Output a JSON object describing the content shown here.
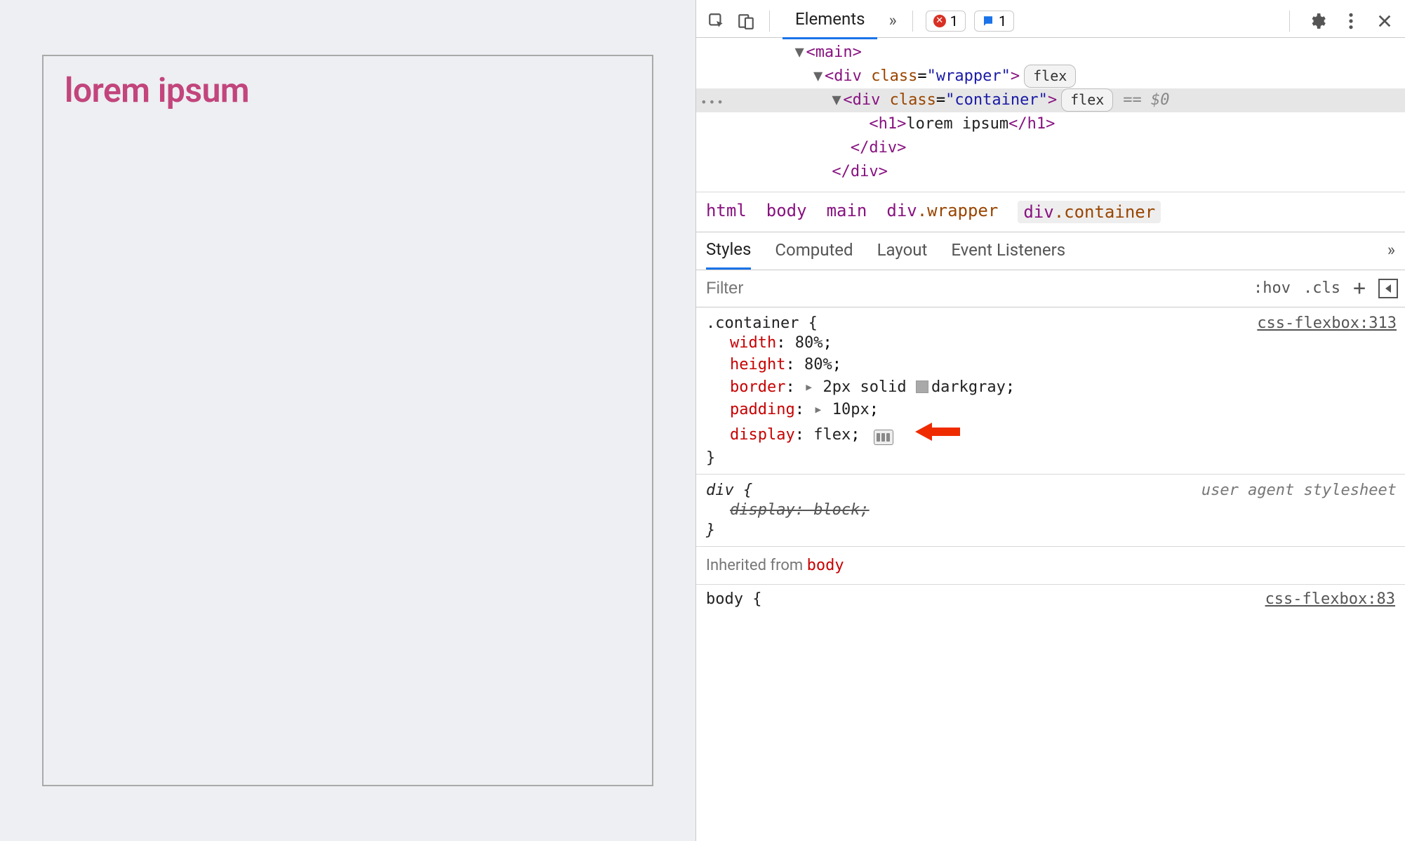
{
  "preview": {
    "heading": "lorem ipsum"
  },
  "toolbar": {
    "tab_elements": "Elements",
    "more_glyph": "»",
    "error_count": "1",
    "issue_count": "1"
  },
  "dom": {
    "line1_tag": "main",
    "line2_tag": "div",
    "line2_attr_name": "class",
    "line2_attr_val": "wrapper",
    "line2_badge": "flex",
    "line3_tag": "div",
    "line3_attr_name": "class",
    "line3_attr_val": "container",
    "line3_badge": "flex",
    "line3_eqthis": "== $0",
    "line4_tag": "h1",
    "line4_text": "lorem ipsum",
    "line5_close": "div",
    "line6_close": "div"
  },
  "crumbs": {
    "c1": "html",
    "c2": "body",
    "c3": "main",
    "c4_el": "div",
    "c4_cls": ".wrapper",
    "c5_el": "div",
    "c5_cls": ".container"
  },
  "subtabs": {
    "t1": "Styles",
    "t2": "Computed",
    "t3": "Layout",
    "t4": "Event Listeners",
    "more": "»"
  },
  "filter": {
    "placeholder": "Filter",
    "hov": ":hov",
    "cls": ".cls",
    "plus": "+"
  },
  "rule1": {
    "selector": ".container",
    "source": "css-flexbox:313",
    "p1": "width",
    "v1": "80%",
    "p2": "height",
    "v2": "80%",
    "p3": "border",
    "v3_a": "2px solid",
    "v3_b": "darkgray",
    "p4": "padding",
    "v4": "10px",
    "p5": "display",
    "v5": "flex"
  },
  "rule2": {
    "selector": "div",
    "source": "user agent stylesheet",
    "strike": "display: block;"
  },
  "inherit": {
    "label": "Inherited from",
    "from": "body"
  },
  "rule3": {
    "selector": "body {",
    "source": "css-flexbox:83"
  }
}
